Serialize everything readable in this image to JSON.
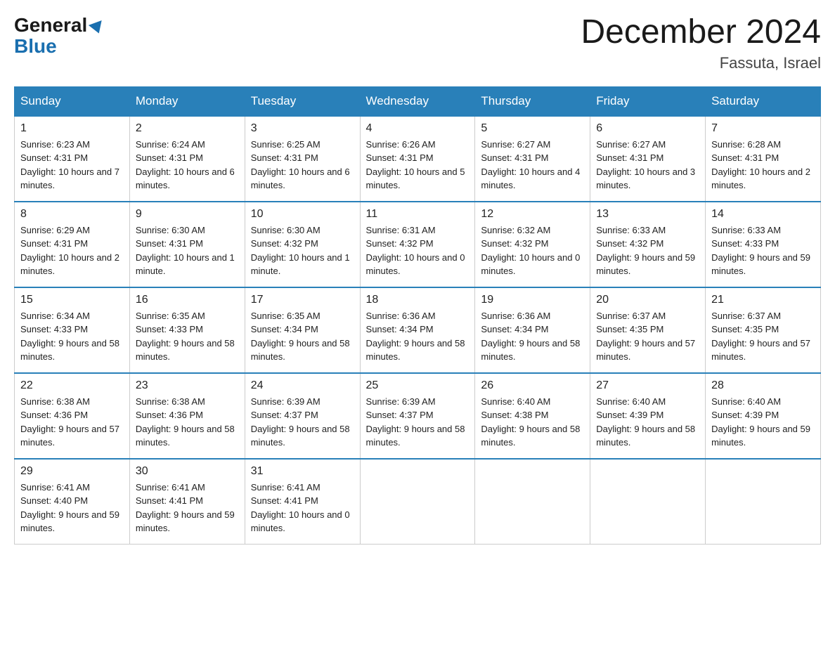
{
  "header": {
    "logo_general": "General",
    "logo_blue": "Blue",
    "month_title": "December 2024",
    "location": "Fassuta, Israel"
  },
  "days_of_week": [
    "Sunday",
    "Monday",
    "Tuesday",
    "Wednesday",
    "Thursday",
    "Friday",
    "Saturday"
  ],
  "weeks": [
    [
      {
        "day": "1",
        "sunrise": "6:23 AM",
        "sunset": "4:31 PM",
        "daylight": "10 hours and 7 minutes."
      },
      {
        "day": "2",
        "sunrise": "6:24 AM",
        "sunset": "4:31 PM",
        "daylight": "10 hours and 6 minutes."
      },
      {
        "day": "3",
        "sunrise": "6:25 AM",
        "sunset": "4:31 PM",
        "daylight": "10 hours and 6 minutes."
      },
      {
        "day": "4",
        "sunrise": "6:26 AM",
        "sunset": "4:31 PM",
        "daylight": "10 hours and 5 minutes."
      },
      {
        "day": "5",
        "sunrise": "6:27 AM",
        "sunset": "4:31 PM",
        "daylight": "10 hours and 4 minutes."
      },
      {
        "day": "6",
        "sunrise": "6:27 AM",
        "sunset": "4:31 PM",
        "daylight": "10 hours and 3 minutes."
      },
      {
        "day": "7",
        "sunrise": "6:28 AM",
        "sunset": "4:31 PM",
        "daylight": "10 hours and 2 minutes."
      }
    ],
    [
      {
        "day": "8",
        "sunrise": "6:29 AM",
        "sunset": "4:31 PM",
        "daylight": "10 hours and 2 minutes."
      },
      {
        "day": "9",
        "sunrise": "6:30 AM",
        "sunset": "4:31 PM",
        "daylight": "10 hours and 1 minute."
      },
      {
        "day": "10",
        "sunrise": "6:30 AM",
        "sunset": "4:32 PM",
        "daylight": "10 hours and 1 minute."
      },
      {
        "day": "11",
        "sunrise": "6:31 AM",
        "sunset": "4:32 PM",
        "daylight": "10 hours and 0 minutes."
      },
      {
        "day": "12",
        "sunrise": "6:32 AM",
        "sunset": "4:32 PM",
        "daylight": "10 hours and 0 minutes."
      },
      {
        "day": "13",
        "sunrise": "6:33 AM",
        "sunset": "4:32 PM",
        "daylight": "9 hours and 59 minutes."
      },
      {
        "day": "14",
        "sunrise": "6:33 AM",
        "sunset": "4:33 PM",
        "daylight": "9 hours and 59 minutes."
      }
    ],
    [
      {
        "day": "15",
        "sunrise": "6:34 AM",
        "sunset": "4:33 PM",
        "daylight": "9 hours and 58 minutes."
      },
      {
        "day": "16",
        "sunrise": "6:35 AM",
        "sunset": "4:33 PM",
        "daylight": "9 hours and 58 minutes."
      },
      {
        "day": "17",
        "sunrise": "6:35 AM",
        "sunset": "4:34 PM",
        "daylight": "9 hours and 58 minutes."
      },
      {
        "day": "18",
        "sunrise": "6:36 AM",
        "sunset": "4:34 PM",
        "daylight": "9 hours and 58 minutes."
      },
      {
        "day": "19",
        "sunrise": "6:36 AM",
        "sunset": "4:34 PM",
        "daylight": "9 hours and 58 minutes."
      },
      {
        "day": "20",
        "sunrise": "6:37 AM",
        "sunset": "4:35 PM",
        "daylight": "9 hours and 57 minutes."
      },
      {
        "day": "21",
        "sunrise": "6:37 AM",
        "sunset": "4:35 PM",
        "daylight": "9 hours and 57 minutes."
      }
    ],
    [
      {
        "day": "22",
        "sunrise": "6:38 AM",
        "sunset": "4:36 PM",
        "daylight": "9 hours and 57 minutes."
      },
      {
        "day": "23",
        "sunrise": "6:38 AM",
        "sunset": "4:36 PM",
        "daylight": "9 hours and 58 minutes."
      },
      {
        "day": "24",
        "sunrise": "6:39 AM",
        "sunset": "4:37 PM",
        "daylight": "9 hours and 58 minutes."
      },
      {
        "day": "25",
        "sunrise": "6:39 AM",
        "sunset": "4:37 PM",
        "daylight": "9 hours and 58 minutes."
      },
      {
        "day": "26",
        "sunrise": "6:40 AM",
        "sunset": "4:38 PM",
        "daylight": "9 hours and 58 minutes."
      },
      {
        "day": "27",
        "sunrise": "6:40 AM",
        "sunset": "4:39 PM",
        "daylight": "9 hours and 58 minutes."
      },
      {
        "day": "28",
        "sunrise": "6:40 AM",
        "sunset": "4:39 PM",
        "daylight": "9 hours and 59 minutes."
      }
    ],
    [
      {
        "day": "29",
        "sunrise": "6:41 AM",
        "sunset": "4:40 PM",
        "daylight": "9 hours and 59 minutes."
      },
      {
        "day": "30",
        "sunrise": "6:41 AM",
        "sunset": "4:41 PM",
        "daylight": "9 hours and 59 minutes."
      },
      {
        "day": "31",
        "sunrise": "6:41 AM",
        "sunset": "4:41 PM",
        "daylight": "10 hours and 0 minutes."
      },
      null,
      null,
      null,
      null
    ]
  ]
}
